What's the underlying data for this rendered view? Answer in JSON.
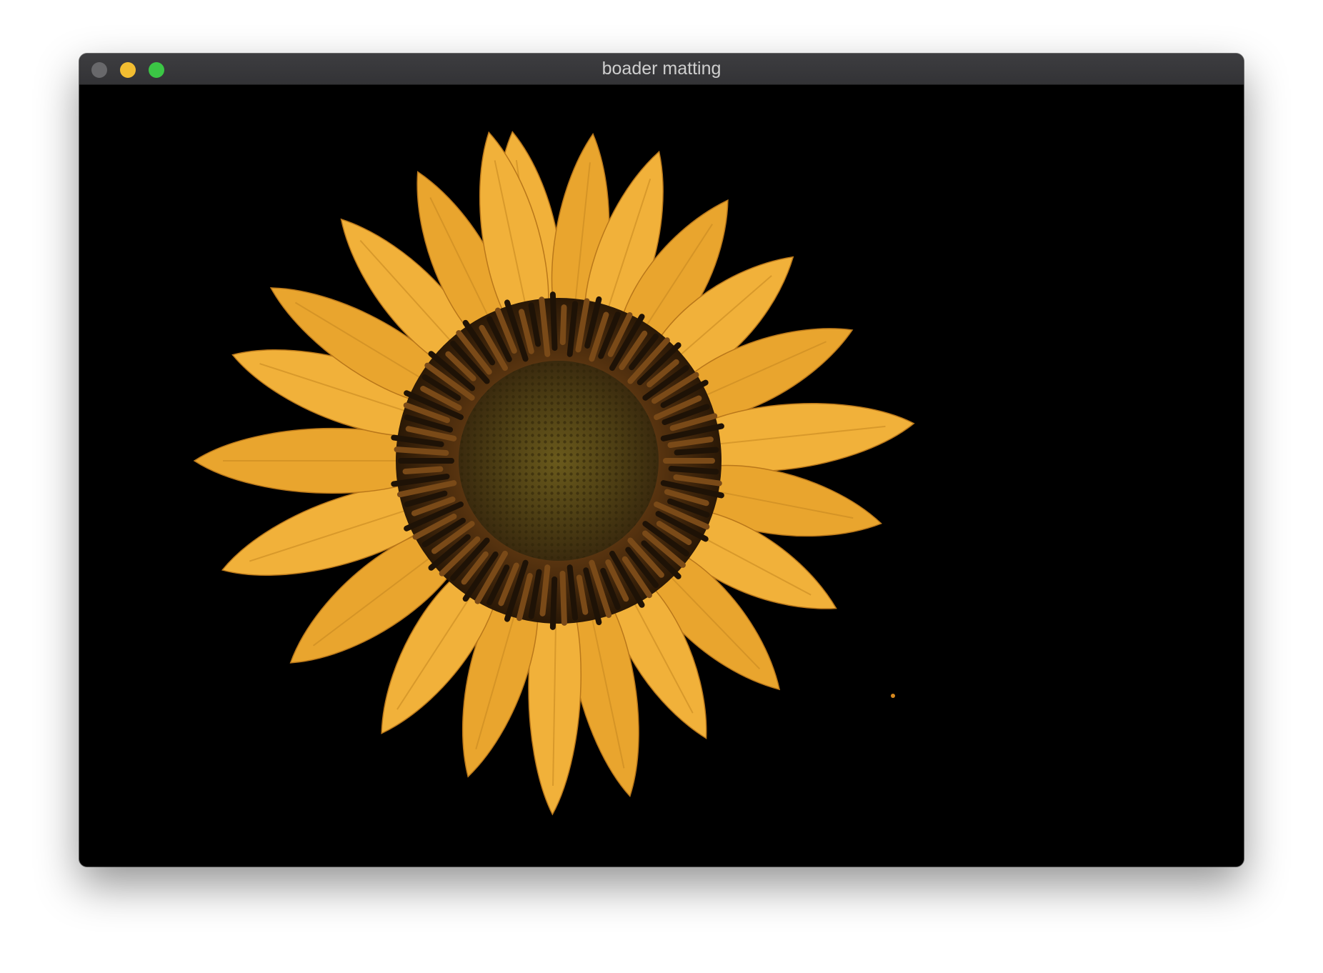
{
  "window": {
    "title": "boader matting",
    "controls": {
      "close": "close-icon",
      "minimize": "minimize-icon",
      "zoom": "zoom-icon"
    },
    "colors": {
      "titlebar": "#37373a",
      "close": "#68686b",
      "minimize": "#f2bd31",
      "zoom": "#3bc645",
      "background": "#000000"
    }
  },
  "image": {
    "subject": "sunflower",
    "background_color": "#000000",
    "petal_color": "#f0ad32",
    "disk_color": "#4a3a12"
  }
}
